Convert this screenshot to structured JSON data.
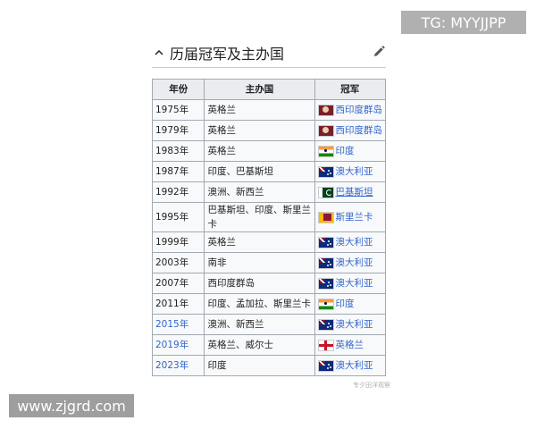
{
  "section": {
    "title": "历届冠军及主办国",
    "icons": {
      "collapse": "chevron-up-icon",
      "edit": "pencil-icon"
    }
  },
  "table": {
    "headers": [
      "年份",
      "主办国",
      "冠军"
    ],
    "rows": [
      {
        "year": "1975年",
        "year_link": false,
        "host": "英格兰",
        "flag": "wi",
        "champion": "西印度群岛",
        "underline": false
      },
      {
        "year": "1979年",
        "year_link": false,
        "host": "英格兰",
        "flag": "wi",
        "champion": "西印度群岛",
        "underline": false
      },
      {
        "year": "1983年",
        "year_link": false,
        "host": "英格兰",
        "flag": "in",
        "champion": "印度",
        "underline": false
      },
      {
        "year": "1987年",
        "year_link": false,
        "host": "印度、巴基斯坦",
        "flag": "au",
        "champion": "澳大利亚",
        "underline": false
      },
      {
        "year": "1992年",
        "year_link": false,
        "host": "澳洲、新西兰",
        "flag": "pk",
        "champion": "巴基斯坦",
        "underline": true
      },
      {
        "year": "1995年",
        "year_link": false,
        "host": "巴基斯坦、印度、斯里兰卡",
        "flag": "lk",
        "champion": "斯里兰卡",
        "underline": false
      },
      {
        "year": "1999年",
        "year_link": false,
        "host": "英格兰",
        "flag": "au",
        "champion": "澳大利亚",
        "underline": false
      },
      {
        "year": "2003年",
        "year_link": false,
        "host": "南非",
        "flag": "au",
        "champion": "澳大利亚",
        "underline": false
      },
      {
        "year": "2007年",
        "year_link": false,
        "host": "西印度群岛",
        "flag": "au",
        "champion": "澳大利亚",
        "underline": false
      },
      {
        "year": "2011年",
        "year_link": false,
        "host": "印度、孟加拉、斯里兰卡",
        "flag": "in",
        "champion": "印度",
        "underline": false
      },
      {
        "year": "2015年",
        "year_link": true,
        "host": "澳洲、新西兰",
        "flag": "au",
        "champion": "澳大利亚",
        "underline": false
      },
      {
        "year": "2019年",
        "year_link": true,
        "host": "英格兰、威尔士",
        "flag": "en",
        "champion": "英格兰",
        "underline": false
      },
      {
        "year": "2023年",
        "year_link": true,
        "host": "印度",
        "flag": "au",
        "champion": "澳大利亚",
        "underline": false
      }
    ]
  },
  "watermarks": {
    "telegram": "TG: MYYJJPP",
    "site": "www.zjgrd.com",
    "small": "专夕田洋观察"
  },
  "colors": {
    "link": "#3366cc",
    "header_bg": "#eaecf0",
    "cell_bg": "#f8f9fa",
    "border": "#a2a9b1"
  }
}
